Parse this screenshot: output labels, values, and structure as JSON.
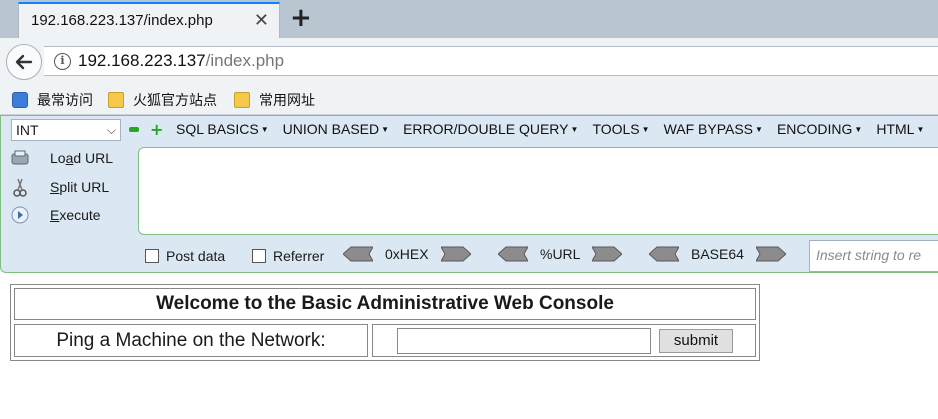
{
  "browser": {
    "tab": {
      "title": "192.168.223.137/index.php",
      "close_glyph": "✕"
    },
    "new_tab_glyph": "+",
    "url": {
      "host": "192.168.223.137",
      "path": "/index.php"
    },
    "bookmarks": [
      {
        "label": "最常访问",
        "icon": "star-icon"
      },
      {
        "label": "火狐官方站点",
        "icon": "folder-icon"
      },
      {
        "label": "常用网址",
        "icon": "folder-icon"
      }
    ]
  },
  "hackbar": {
    "type_select": "INT",
    "menus": [
      "SQL BASICS",
      "UNION BASED",
      "ERROR/DOUBLE QUERY",
      "TOOLS",
      "WAF BYPASS",
      "ENCODING",
      "HTML"
    ],
    "actions": {
      "load": {
        "pre": "Lo",
        "ul": "a",
        "post": "d URL"
      },
      "split": {
        "pre": "",
        "ul": "S",
        "post": "plit URL"
      },
      "execute": {
        "pre": "",
        "ul": "E",
        "post": "xecute"
      }
    },
    "post_data_label": "Post data",
    "referrer_label": "Referrer",
    "encoders": [
      "0xHEX",
      "%URL",
      "BASE64"
    ],
    "insert_placeholder": "Insert string to re"
  },
  "page": {
    "title": "Welcome to the Basic Administrative Web Console",
    "ping_label": "Ping a Machine on the Network:",
    "ping_value": "",
    "submit_label": "submit"
  },
  "colors": {
    "hackbar_bg": "#dbe8f3",
    "hackbar_border": "#7fbf7f",
    "tab_accent": "#0a84ff"
  }
}
